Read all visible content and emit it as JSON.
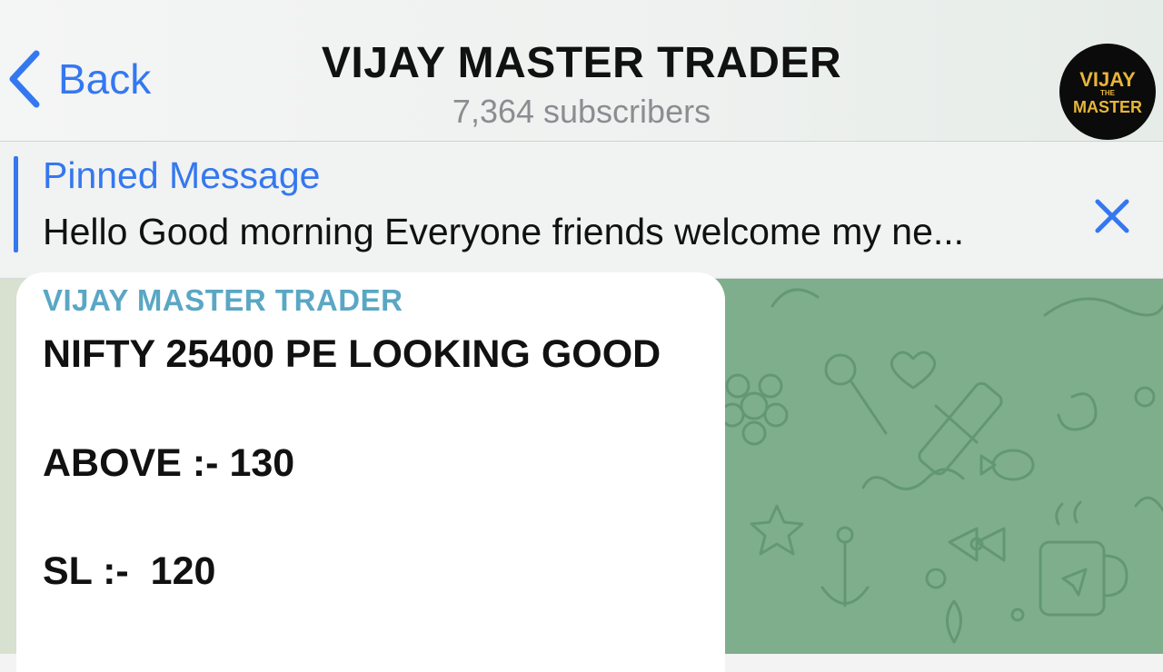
{
  "header": {
    "back_label": "Back",
    "channel_title": "VIJAY MASTER TRADER",
    "subscribers": "7,364 subscribers",
    "avatar_text_top": "VIJAY",
    "avatar_text_mid": "THE",
    "avatar_text_bottom": "MASTER"
  },
  "pinned": {
    "title": "Pinned Message",
    "text": "Hello Good morning Everyone friends welcome my ne..."
  },
  "message": {
    "sender": "VIJAY MASTER TRADER",
    "lines": [
      "NIFTY 25400 PE LOOKING GOOD",
      "ABOVE :- 130",
      "SL :-  120"
    ]
  },
  "colors": {
    "accent_blue": "#3478f0",
    "sender_color": "#5aa7c4",
    "chat_bg": "#7fae8d",
    "avatar_gold": "#e8b53a"
  },
  "icons": [
    "chevron-left-icon",
    "close-icon",
    "channel-avatar-logo"
  ]
}
